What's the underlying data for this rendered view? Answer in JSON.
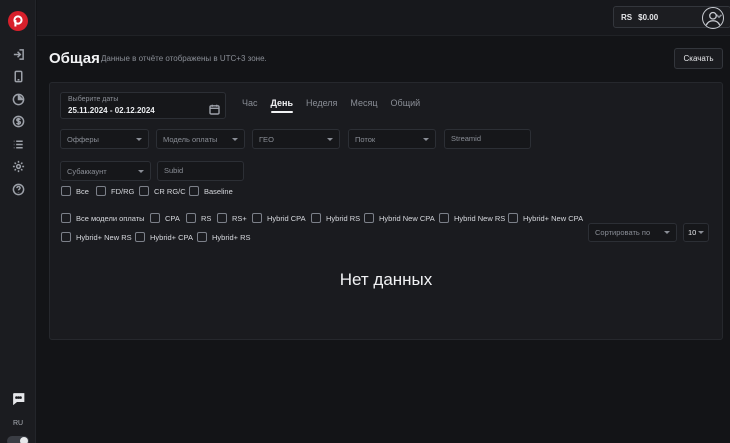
{
  "sidebar": {
    "items": [
      {
        "icon": "import-icon"
      },
      {
        "icon": "mobile-icon"
      },
      {
        "icon": "pie-chart-icon"
      },
      {
        "icon": "dollar-icon"
      },
      {
        "icon": "list-icon"
      },
      {
        "icon": "gear-icon"
      },
      {
        "icon": "help-icon"
      }
    ],
    "chat_icon": "chat-icon",
    "language": "RU"
  },
  "topbar": {
    "currency": "RS",
    "balance": "$0.00"
  },
  "header": {
    "title": "Общая",
    "subtitle": "Данные в отчёте отображены в UTC+3 зоне.",
    "download_label": "Скачать"
  },
  "date_picker": {
    "label": "Выберите даты",
    "value": "25.11.2024 - 02.12.2024"
  },
  "tabs": [
    {
      "label": "Час",
      "active": false
    },
    {
      "label": "День",
      "active": true
    },
    {
      "label": "Неделя",
      "active": false
    },
    {
      "label": "Месяц",
      "active": false
    },
    {
      "label": "Общий",
      "active": false
    }
  ],
  "filters": {
    "offers": "Офферы",
    "payment_model": "Модель оплаты",
    "geo": "ГЕО",
    "stream": "Поток",
    "streamid_placeholder": "Streamid",
    "subaccount": "Субаккаунт",
    "subid_placeholder": "Subid"
  },
  "metric_checkboxes": [
    "Все",
    "FD/RG",
    "CR RG/C",
    "Baseline"
  ],
  "model_checkboxes": [
    "Все модели оплаты",
    "CPA",
    "RS",
    "RS+",
    "Hybrid CPA",
    "Hybrid RS",
    "Hybrid New CPA",
    "Hybrid New RS",
    "Hybrid+ New CPA",
    "Hybrid+ New RS",
    "Hybrid+ CPA",
    "Hybrid+ RS"
  ],
  "sort": {
    "label": "Сортировать по",
    "count": "10"
  },
  "empty_message": "Нет данных"
}
